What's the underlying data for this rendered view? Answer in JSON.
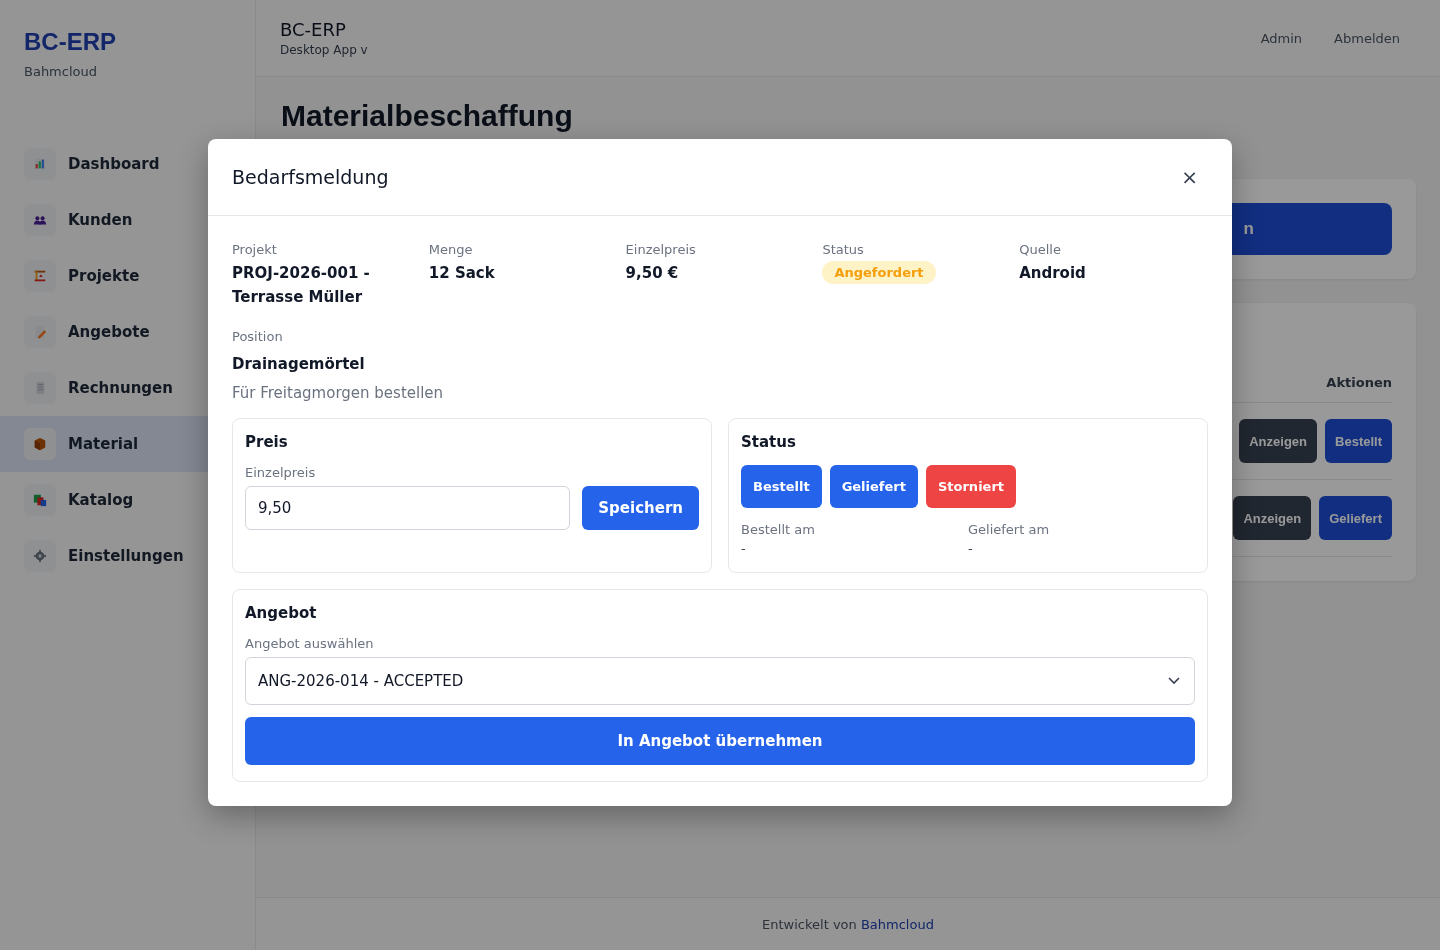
{
  "brand": {
    "logo": "BC-ERP",
    "company": "Bahmcloud"
  },
  "nav": [
    {
      "label": "Dashboard",
      "selected": false
    },
    {
      "label": "Kunden",
      "selected": false
    },
    {
      "label": "Projekte",
      "selected": false
    },
    {
      "label": "Angebote",
      "selected": false
    },
    {
      "label": "Rechnungen",
      "selected": false
    },
    {
      "label": "Material",
      "selected": true
    },
    {
      "label": "Katalog",
      "selected": false
    },
    {
      "label": "Einstellungen",
      "selected": false
    }
  ],
  "header": {
    "title": "BC-ERP",
    "subtitle": "Desktop App v",
    "links": [
      "Admin",
      "Abmelden"
    ]
  },
  "page_title": "Materialbeschaffung",
  "background": {
    "primary_button": "n",
    "column": "Aktionen",
    "rows": [
      [
        "Anzeigen",
        "Bestellt"
      ],
      [
        "Anzeigen",
        "Geliefert"
      ]
    ]
  },
  "footer": {
    "text": "Entwickelt von",
    "link": "Bahmcloud"
  },
  "modal": {
    "title": "Bedarfsmeldung",
    "close": "×",
    "details": [
      {
        "label": "Projekt",
        "value": "PROJ-2026-001 - Terrasse Müller",
        "kind": "text"
      },
      {
        "label": "Menge",
        "value": "12 Sack",
        "kind": "text"
      },
      {
        "label": "Einzelpreis",
        "value": "9,50 €",
        "kind": "text"
      },
      {
        "label": "Status",
        "value": "Angefordert",
        "kind": "badge"
      },
      {
        "label": "Quelle",
        "value": "Android",
        "kind": "text"
      }
    ],
    "position_label": "Position",
    "position": "Drainagemörtel",
    "note": "Für Freitagmorgen bestellen",
    "price": {
      "title": "Preis",
      "label": "Einzelpreis",
      "value": "9,50",
      "button": "Speichern"
    },
    "status": {
      "title": "Status",
      "buttons": [
        {
          "label": "Bestellt",
          "kind": "primary"
        },
        {
          "label": "Geliefert",
          "kind": "primary"
        },
        {
          "label": "Storniert",
          "kind": "danger"
        }
      ],
      "dates": [
        {
          "label": "Bestellt am",
          "value": "-"
        },
        {
          "label": "Geliefert am",
          "value": "-"
        }
      ]
    },
    "offer": {
      "title": "Angebot",
      "label": "Angebot auswählen",
      "value": "ANG-2026-014 - ACCEPTED",
      "button": "In Angebot übernehmen"
    }
  }
}
